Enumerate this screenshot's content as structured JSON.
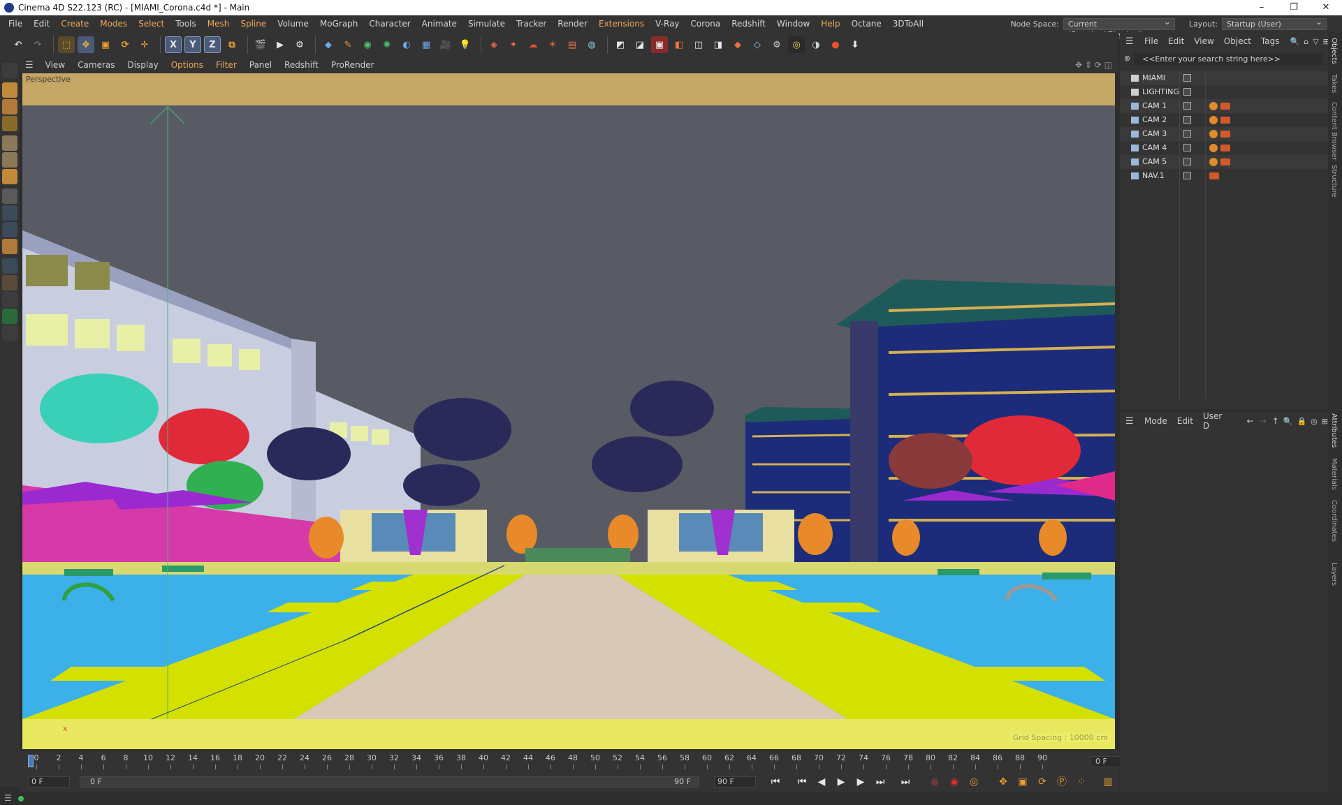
{
  "window": {
    "title": "Cinema 4D S22.123 (RC) - [MIAMI_Corona.c4d *] - Main",
    "controls": [
      "–",
      "❐",
      "✕"
    ]
  },
  "menubar": {
    "items": [
      "File",
      "Edit",
      "Create",
      "Modes",
      "Select",
      "Tools",
      "Mesh",
      "Spline",
      "Volume",
      "MoGraph",
      "Character",
      "Animate",
      "Simulate",
      "Tracker",
      "Render",
      "Extensions",
      "V-Ray",
      "Corona",
      "Redshift",
      "Window",
      "Help",
      "Octane",
      "3DToAll"
    ],
    "node_space_label": "Node Space:",
    "node_space_value": "Current (Standard/Physical)",
    "layout_label": "Layout:",
    "layout_value": "Startup (User)"
  },
  "toolbar": {
    "axis_x": "X",
    "axis_y": "Y",
    "axis_z": "Z"
  },
  "viewport": {
    "menu": [
      "View",
      "Cameras",
      "Display",
      "Options",
      "Filter",
      "Panel",
      "Redshift",
      "ProRender"
    ],
    "label": "Perspective",
    "grid_spacing": "Grid Spacing : 10000 cm",
    "axis_x_label": "x"
  },
  "timeline": {
    "ticks": [
      "0",
      "2",
      "4",
      "6",
      "8",
      "10",
      "12",
      "14",
      "16",
      "18",
      "20",
      "22",
      "24",
      "26",
      "28",
      "30",
      "32",
      "34",
      "36",
      "38",
      "40",
      "42",
      "44",
      "46",
      "48",
      "50",
      "52",
      "54",
      "56",
      "58",
      "60",
      "62",
      "64",
      "66",
      "68",
      "70",
      "72",
      "74",
      "76",
      "78",
      "80",
      "82",
      "84",
      "86",
      "88",
      "90"
    ],
    "current_frame": "0 F"
  },
  "transport": {
    "start": "0 F",
    "range_start": "0 F",
    "range_end": "90 F",
    "end": "90 F"
  },
  "object_manager": {
    "menu": [
      "File",
      "Edit",
      "View",
      "Object",
      "Tags"
    ],
    "search_placeholder": "<<Enter your search string here>>",
    "objects": [
      {
        "name": "MIAMI",
        "type": "layer"
      },
      {
        "name": "LIGHTING",
        "type": "layer"
      },
      {
        "name": "CAM 1",
        "type": "camera"
      },
      {
        "name": "CAM 2",
        "type": "camera"
      },
      {
        "name": "CAM 3",
        "type": "camera"
      },
      {
        "name": "CAM 4",
        "type": "camera"
      },
      {
        "name": "CAM 5",
        "type": "camera"
      },
      {
        "name": "NAV.1",
        "type": "camera"
      }
    ]
  },
  "attribute_manager": {
    "menu": [
      "Mode",
      "Edit",
      "User D"
    ]
  },
  "right_tabs": [
    "Objects",
    "Takes",
    "Content Browser",
    "Structure",
    "Attributes",
    "Materials",
    "Coordinates",
    "Layers"
  ]
}
